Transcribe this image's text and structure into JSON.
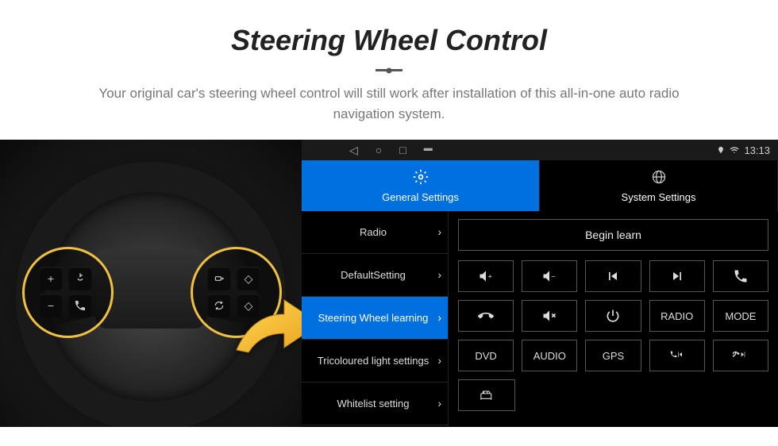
{
  "header": {
    "title": "Steering Wheel Control",
    "subtitle": "Your original car's steering wheel control will still work after installation of this all-in-one auto radio navigation system."
  },
  "status": {
    "time": "13:13"
  },
  "tabs": {
    "general": "General Settings",
    "system": "System Settings"
  },
  "menu": {
    "radio": "Radio",
    "default": "DefaultSetting",
    "swl": "Steering Wheel learning",
    "tricolour": "Tricoloured light settings",
    "whitelist": "Whitelist setting"
  },
  "panel": {
    "begin_learn": "Begin learn",
    "buttons": {
      "radio": "RADIO",
      "mode": "MODE",
      "dvd": "DVD",
      "audio": "AUDIO",
      "gps": "GPS"
    }
  }
}
